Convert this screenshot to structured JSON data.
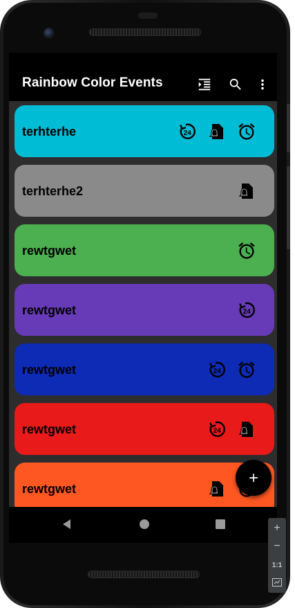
{
  "app": {
    "title": "Rainbow Color Events",
    "toolbar": {
      "sort_icon": "format-indent-icon",
      "search_icon": "search-icon",
      "more_icon": "more-vert-icon"
    }
  },
  "events": [
    {
      "title": "terhterhe",
      "color": "#00BCD4",
      "icons": [
        "repeat-24-icon",
        "notification-file-icon",
        "alarm-icon"
      ]
    },
    {
      "title": "terhterhe2",
      "color": "#8A8A8A",
      "icons": [
        "notification-file-icon"
      ]
    },
    {
      "title": "rewtgwet",
      "color": "#4CAF50",
      "icons": [
        "alarm-icon"
      ]
    },
    {
      "title": "rewtgwet",
      "color": "#673AB7",
      "icons": [
        "repeat-24-icon"
      ]
    },
    {
      "title": "rewtgwet",
      "color": "#0D2BB5",
      "icons": [
        "repeat-24-icon",
        "alarm-icon"
      ]
    },
    {
      "title": "rewtgwet",
      "color": "#E91A1A",
      "icons": [
        "repeat-24-icon",
        "notification-file-icon"
      ]
    },
    {
      "title": "rewtgwet",
      "color": "#FF5722",
      "icons": [
        "notification-file-icon",
        "alarm-icon"
      ]
    }
  ],
  "fab": {
    "icon": "add-icon",
    "label": "+"
  },
  "nav": {
    "back_icon": "back-triangle-icon",
    "home_icon": "home-circle-icon",
    "recents_icon": "recents-square-icon"
  },
  "emulator_toolbar": {
    "zoom_in": "+",
    "zoom_out": "−",
    "one_to_one": "1:1",
    "fit_icon": "fit-screen-icon"
  }
}
